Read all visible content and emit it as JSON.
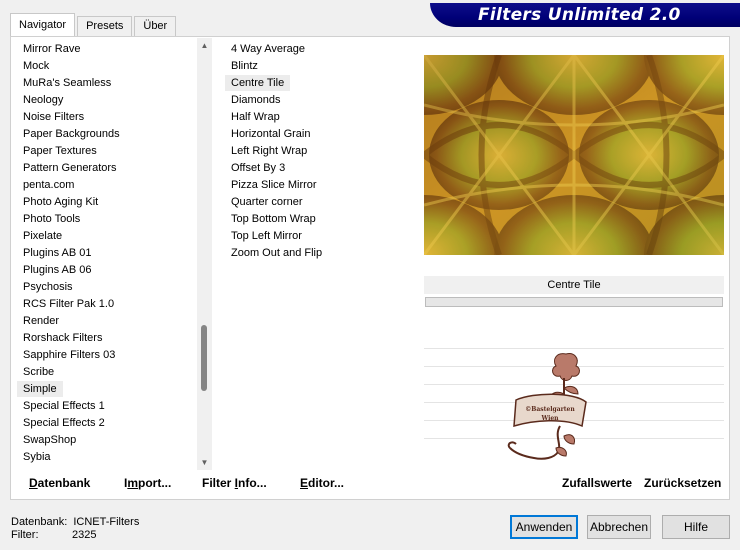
{
  "tabs": [
    "Navigator",
    "Presets",
    "Über"
  ],
  "app_title": "Filters Unlimited 2.0",
  "categories": [
    "Mirror Rave",
    "Mock",
    "MuRa's Seamless",
    "Neology",
    "Noise Filters",
    "Paper Backgrounds",
    "Paper Textures",
    "Pattern Generators",
    "penta.com",
    "Photo Aging Kit",
    "Photo Tools",
    "Pixelate",
    "Plugins AB 01",
    "Plugins AB 06",
    "Psychosis",
    "RCS Filter Pak 1.0",
    "Render",
    "Rorshack Filters",
    "Sapphire Filters 03",
    "Scribe",
    "Simple",
    "Special Effects 1",
    "Special Effects 2",
    "SwapShop",
    "Sybia"
  ],
  "selected_category": "Simple",
  "filters": [
    "4 Way Average",
    "Blintz",
    "Centre Tile",
    "Diamonds",
    "Half Wrap",
    "Horizontal Grain",
    "Left Right Wrap",
    "Offset By 3",
    "Pizza Slice Mirror",
    "Quarter corner",
    "Top Bottom Wrap",
    "Top Left Mirror",
    "Zoom Out and Flip"
  ],
  "selected_filter": "Centre Tile",
  "preview": {
    "filter_name": "Centre Tile"
  },
  "watermark_text": [
    "©Bastelgarten",
    "Wien"
  ],
  "buttons": {
    "datenbank": {
      "u": "D",
      "rest": "atenbank"
    },
    "import": {
      "pre": "I",
      "u": "m",
      "rest": "port..."
    },
    "filter_info": {
      "pre": "Filter ",
      "u": "I",
      "rest": "nfo..."
    },
    "editor": {
      "u": "E",
      "rest": "ditor..."
    },
    "zufallswerte": "Zufallswerte",
    "zuruecksetzen": "Zurücksetzen",
    "anwenden": "Anwenden",
    "abbrechen": "Abbrechen",
    "hilfe": "Hilfe"
  },
  "status": {
    "datenbank_label": "Datenbank:",
    "datenbank_value": "ICNET-Filters",
    "filter_label": "Filter:",
    "filter_value": "2325"
  },
  "colors": {
    "preview_gold": "#d8a62a",
    "preview_brown": "#6e3a0c",
    "preview_green": "#8a9a22",
    "logo_blue": "#000078"
  }
}
